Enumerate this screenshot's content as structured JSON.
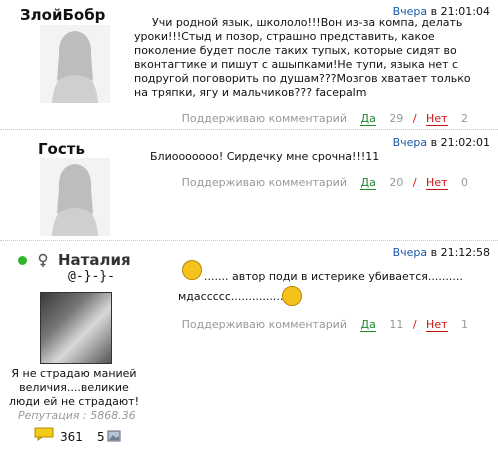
{
  "posts": [
    {
      "author": "ЗлойБобр",
      "time_day": "Вчера",
      "time_rest": "в 21:01:04",
      "text": "Учи родной язык, школоло!!!Вон из-за компа, делать уроки!!!Стыд и позор, страшно представить, какое поколение будет после таких тупых, которые сидят во вконтагтике и пишут с ашыпками!Не тупи, языка нет с подругой поговорить по душам???Мозгов хватает только на тряпки, ягу и мальчиков??? facepalm",
      "support_label": "Поддерживаю комментарий",
      "yes_label": "Да",
      "yes_count": "29",
      "slash": "/",
      "no_label": "Нет",
      "no_count": "2"
    },
    {
      "author": "Гость",
      "time_day": "Вчера",
      "time_rest": "в 21:02:01",
      "text": "Блиооооооо! Сирдечку мне срочна!!!11",
      "support_label": "Поддерживаю комментарий",
      "yes_label": "Да",
      "yes_count": "20",
      "slash": "/",
      "no_label": "Нет",
      "no_count": "0"
    },
    {
      "author": "Наталия",
      "sub": "@-}-}-",
      "time_day": "Вчера",
      "time_rest": "в 21:12:58",
      "line1": "....... автор поди в истерике убивается..........",
      "line2": "мдассссс...................",
      "support_label": "Поддерживаю комментарий",
      "yes_label": "Да",
      "yes_count": "11",
      "slash": "/",
      "no_label": "Нет",
      "no_count": "1",
      "caption": "Я не страдаю манией величия....великие люди ей не страдают!",
      "reputation": "Репутация : 5868.36",
      "comments": "361",
      "photos": "5",
      "online_color": "#2db52d"
    }
  ]
}
